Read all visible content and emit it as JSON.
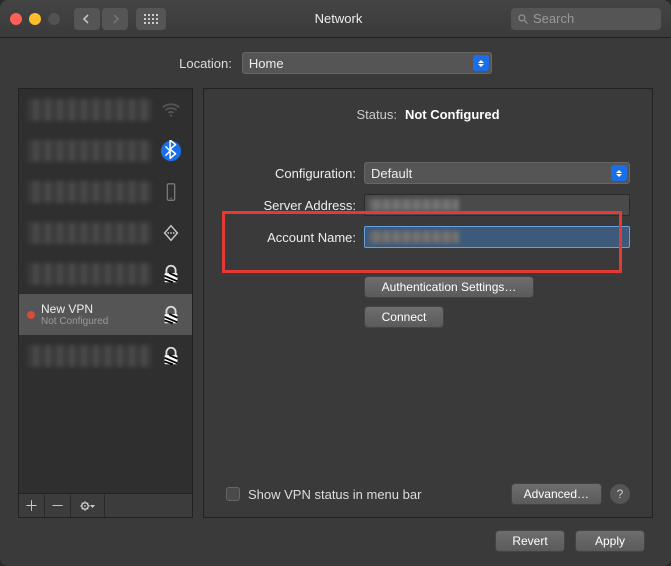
{
  "window": {
    "title": "Network",
    "search_placeholder": "Search"
  },
  "location": {
    "label": "Location:",
    "value": "Home"
  },
  "sidebar": {
    "items": [
      {
        "name": "",
        "sub": "",
        "icon": "wifi",
        "redacted": true
      },
      {
        "name": "",
        "sub": "",
        "icon": "bluetooth",
        "redacted": true
      },
      {
        "name": "",
        "sub": "",
        "icon": "phone",
        "redacted": true
      },
      {
        "name": "",
        "sub": "",
        "icon": "diamond",
        "redacted": true
      },
      {
        "name": "",
        "sub": "",
        "icon": "lock",
        "redacted": true
      },
      {
        "name": "New VPN",
        "sub": "Not Configured",
        "icon": "lock",
        "status": "red",
        "selected": true
      },
      {
        "name": "",
        "sub": "",
        "icon": "lock",
        "redacted": true
      }
    ]
  },
  "status": {
    "label": "Status:",
    "value": "Not Configured"
  },
  "config": {
    "label": "Configuration:",
    "value": "Default"
  },
  "server": {
    "label": "Server Address:",
    "value": ""
  },
  "account": {
    "label": "Account Name:",
    "value": ""
  },
  "buttons": {
    "auth": "Authentication Settings…",
    "connect": "Connect",
    "advanced": "Advanced…",
    "revert": "Revert",
    "apply": "Apply"
  },
  "showvpn": {
    "label": "Show VPN status in menu bar",
    "checked": false
  },
  "help": "?"
}
